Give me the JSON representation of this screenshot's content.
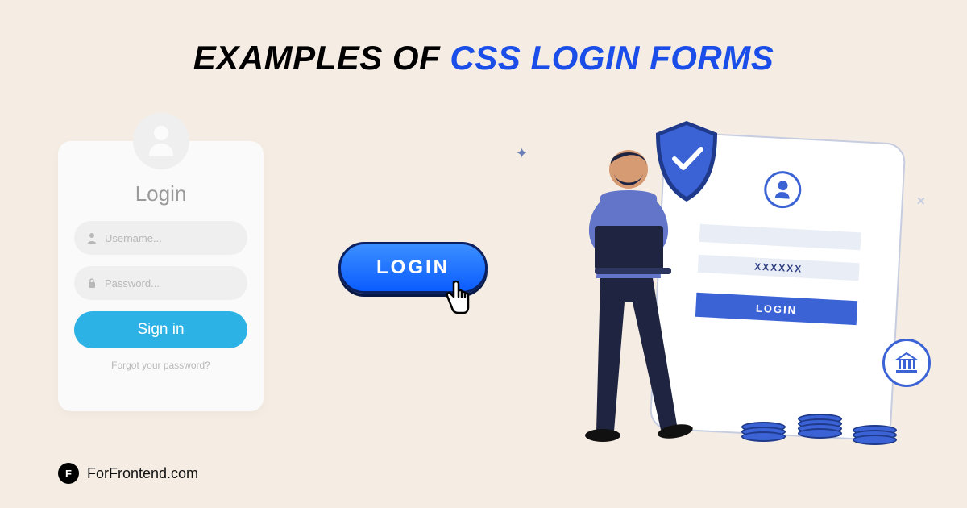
{
  "heading": {
    "part1": "EXAMPLES OF ",
    "part2": "CSS LOGIN FORMS"
  },
  "login_card": {
    "title": "Login",
    "username_placeholder": "Username...",
    "password_placeholder": "Password...",
    "signin_label": "Sign in",
    "forgot_label": "Forgot your password?"
  },
  "center_button": {
    "label": "LOGIN"
  },
  "tablet_form": {
    "password_mask": "XXXXXX",
    "login_label": "LOGIN"
  },
  "footer": {
    "logo_letter": "F",
    "brand": "ForFrontend.com"
  },
  "colors": {
    "bg": "#f5ede3",
    "accent_blue": "#1b4ee8",
    "cyan": "#2db2e6",
    "indigo": "#3b63d6"
  }
}
